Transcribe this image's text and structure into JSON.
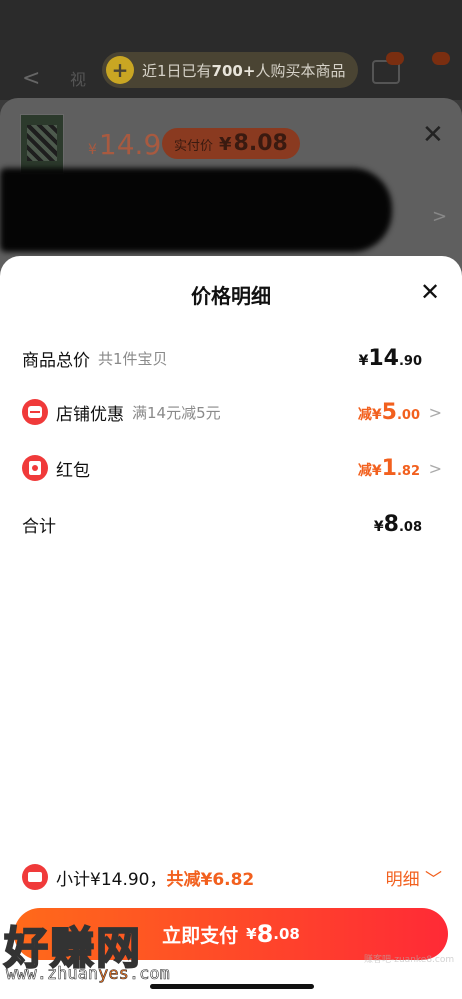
{
  "background": {
    "promo": {
      "prefix": "近1日已有",
      "count": "700+",
      "suffix": "人购买本商品"
    },
    "nav_text": "视",
    "product": {
      "price_currency": "¥",
      "price": "14.9",
      "actual_label": "实付价",
      "actual_currency": "¥",
      "actual_price": "8.08"
    }
  },
  "sheet": {
    "title": "价格明细",
    "rows": [
      {
        "label": "商品总价",
        "sub": "共1件宝贝",
        "prefix": "",
        "currency": "¥",
        "int": "14",
        "dec": ".90"
      },
      {
        "label": "店铺优惠",
        "sub": "满14元减5元",
        "prefix": "减",
        "currency": "¥",
        "int": "5",
        "dec": ".00"
      },
      {
        "label": "红包",
        "sub": "",
        "prefix": "减",
        "currency": "¥",
        "int": "1",
        "dec": ".82"
      },
      {
        "label": "合计",
        "sub": "",
        "prefix": "",
        "currency": "¥",
        "int": "8",
        "dec": ".08"
      }
    ],
    "subtotal_text": "小计¥14.90，",
    "saving_text": "共减¥6.82",
    "detail_link": "明细 ﹀",
    "pay_button": {
      "label": "立即支付",
      "currency": "¥",
      "int": "8",
      "dec": ".08"
    }
  },
  "watermark": {
    "logo_text": "好赚网",
    "url_prefix": "www.zhuan",
    "url_highlight": "yes",
    "url_suffix": ".com",
    "small": "赚客吧-zuanke8.com"
  },
  "colors": {
    "accent": "#f2601e",
    "danger": "#f03a3a"
  }
}
